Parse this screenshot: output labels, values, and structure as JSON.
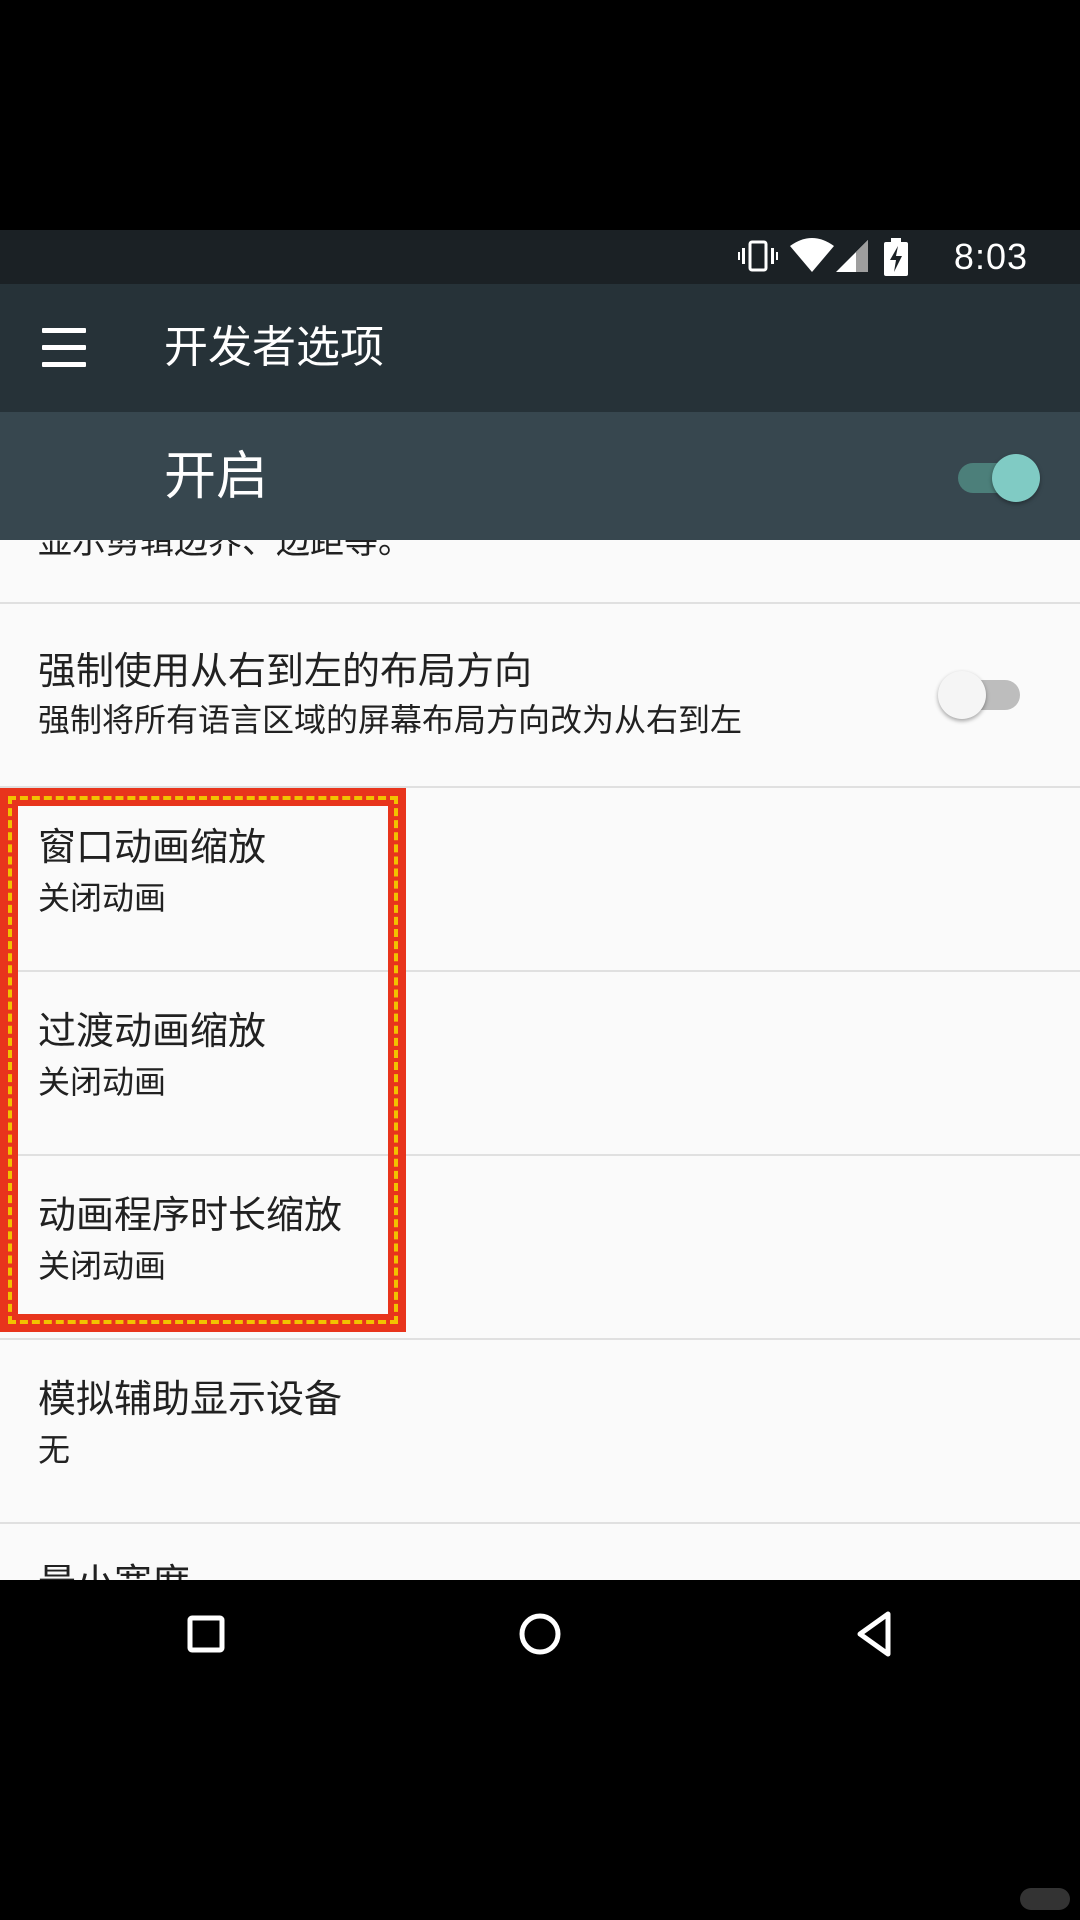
{
  "status_bar": {
    "time": "8:03",
    "icons": [
      "vibrate-icon",
      "wifi-icon",
      "cell-signal-icon",
      "battery-charging-icon"
    ]
  },
  "app_bar": {
    "menu_icon": "menu-icon",
    "title": "开发者选项"
  },
  "master_switch": {
    "label": "开启",
    "state": "on",
    "accent": "#80cbc4"
  },
  "settings": {
    "partial_text": "显示剪辑边界、边距等。",
    "items": [
      {
        "title": "强制使用从右到左的布局方向",
        "summary": "强制将所有语言区域的屏幕布局方向改为从右到左",
        "toggle": "off"
      },
      {
        "title": "窗口动画缩放",
        "summary": "关闭动画"
      },
      {
        "title": "过渡动画缩放",
        "summary": "关闭动画"
      },
      {
        "title": "动画程序时长缩放",
        "summary": "关闭动画"
      },
      {
        "title": "模拟辅助显示设备",
        "summary": "无"
      },
      {
        "title": "最小宽度",
        "summary": ""
      }
    ]
  },
  "highlight": {
    "color": "#e8341c",
    "covers": [
      "窗口动画缩放",
      "过渡动画缩放",
      "动画程序时长缩放"
    ]
  },
  "nav_bar": {
    "icons": [
      "recents-icon",
      "home-icon",
      "back-icon"
    ]
  }
}
